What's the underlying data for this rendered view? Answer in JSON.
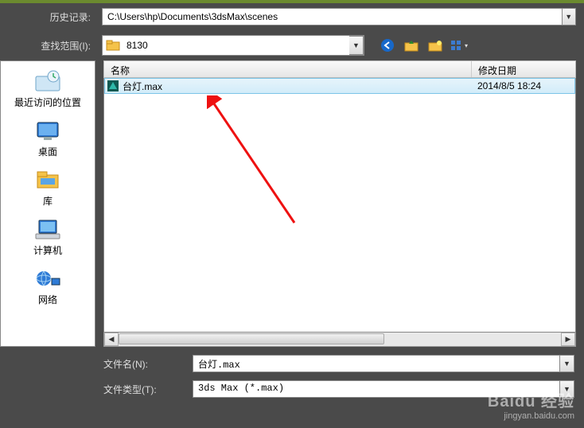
{
  "history": {
    "label": "历史记录:",
    "value": "C:\\Users\\hp\\Documents\\3dsMax\\scenes"
  },
  "lookin": {
    "label": "查找范围(I):",
    "value": "8130"
  },
  "toolbar": {
    "back": "back-icon",
    "up": "up-icon",
    "new": "new-folder-icon",
    "view": "view-mode-icon"
  },
  "places": [
    {
      "label": "最近访问的位置"
    },
    {
      "label": "桌面"
    },
    {
      "label": "库"
    },
    {
      "label": "计算机"
    },
    {
      "label": "网络"
    }
  ],
  "columns": {
    "name": "名称",
    "date": "修改日期"
  },
  "files": [
    {
      "name": "台灯.max",
      "date": "2014/8/5 18:24"
    }
  ],
  "filename": {
    "label": "文件名(N):",
    "value": "台灯.max"
  },
  "filetype": {
    "label": "文件类型(T):",
    "value": "3ds Max (*.max)"
  },
  "watermark": {
    "brand": "Baidu 经验",
    "url": "jingyan.baidu.com"
  }
}
